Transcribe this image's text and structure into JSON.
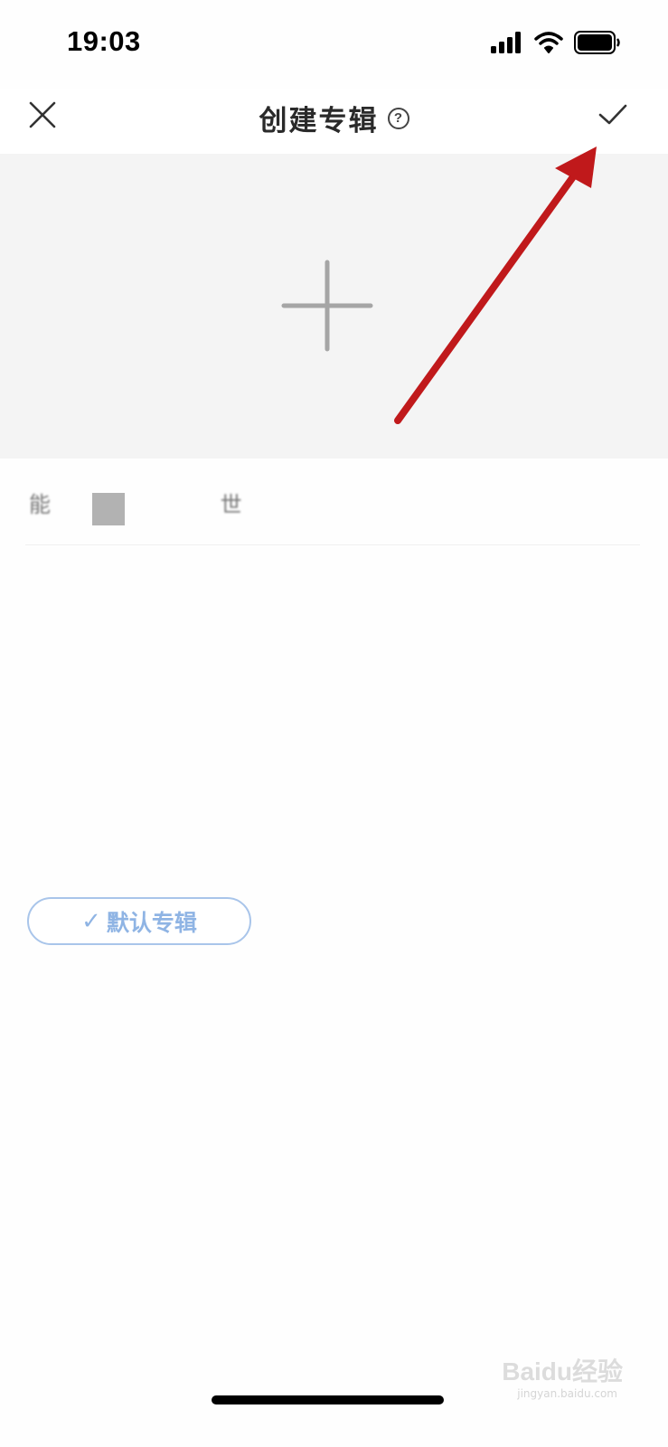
{
  "status_bar": {
    "time": "19:03",
    "icons": [
      "signal-icon",
      "wifi-icon",
      "battery-icon"
    ]
  },
  "nav": {
    "title": "创建专辑",
    "help_glyph": "?",
    "close_icon": "close-icon",
    "confirm_icon": "checkmark-icon"
  },
  "cover": {
    "add_icon": "plus-icon"
  },
  "name_field": {
    "value": "能 世"
  },
  "default_album": {
    "check_glyph": "✓",
    "label": "默认专辑"
  },
  "watermark": {
    "text": "Baidu经验",
    "sub": "jingyan.baidu.com"
  },
  "colors": {
    "annotation_arrow": "#c0191b",
    "default_button_accent": "#8fb4e4",
    "cover_background": "#f4f4f4"
  }
}
